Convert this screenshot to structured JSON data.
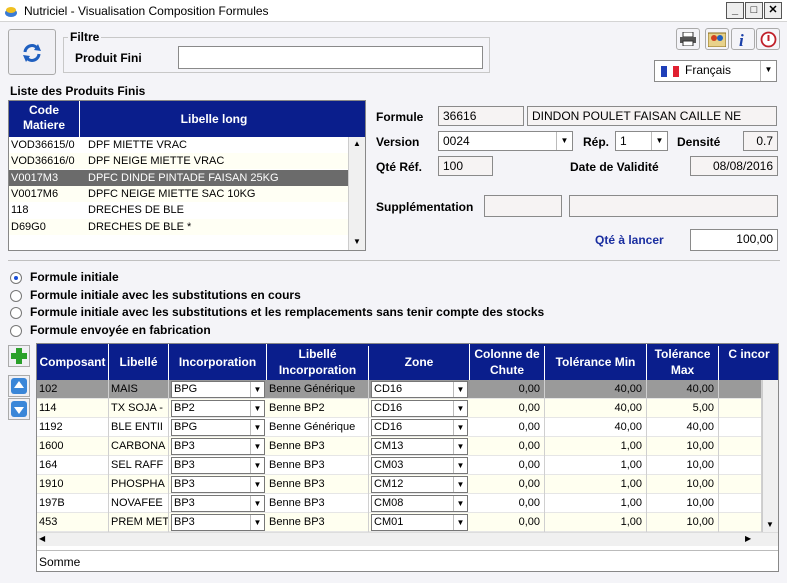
{
  "window": {
    "title": "Nutriciel - Visualisation Composition Formules"
  },
  "filter": {
    "group_label": "Filtre",
    "produit_label": "Produit Fini",
    "produit_value": ""
  },
  "language": {
    "value": "Français"
  },
  "list": {
    "title": "Liste des Produits Finis",
    "col_code": "Code Matiere",
    "col_libelle": "Libelle long",
    "rows": [
      {
        "code": "VOD36615/0",
        "libelle": "DPF MIETTE VRAC"
      },
      {
        "code": "VOD36616/0",
        "libelle": "DPF NEIGE MIETTE VRAC"
      },
      {
        "code": "V0017M3",
        "libelle": "DPFC DINDE PINTADE FAISAN 25KG"
      },
      {
        "code": "V0017M6",
        "libelle": "DPFC NEIGE MIETTE SAC 10KG"
      },
      {
        "code": "118",
        "libelle": "DRECHES DE BLE"
      },
      {
        "code": "D69G0",
        "libelle": "DRECHES DE BLE *"
      }
    ]
  },
  "formule": {
    "formule_label": "Formule",
    "formule_code": "36616",
    "formule_name": "DINDON POULET FAISAN CAILLE NE",
    "version_label": "Version",
    "version_value": "0024",
    "rep_label": "Rép.",
    "rep_value": "1",
    "densite_label": "Densité",
    "densite_value": "0.7",
    "qte_ref_label": "Qté Réf.",
    "qte_ref_value": "100",
    "validite_label": "Date de Validité",
    "validite_value": "08/08/2016",
    "supp_label": "Supplémentation",
    "supp_value1": "",
    "supp_value2": "",
    "qte_lancer_label": "Qté à lancer",
    "qte_lancer_value": "100,00"
  },
  "radios": [
    {
      "label": "Formule initiale",
      "checked": true
    },
    {
      "label": "Formule initiale avec les substitutions en cours",
      "checked": false
    },
    {
      "label": "Formule initiale avec les substitutions et les remplacements sans tenir compte des stocks",
      "checked": false
    },
    {
      "label": "Formule envoyée en fabrication",
      "checked": false
    }
  ],
  "grid": {
    "headers": {
      "composant": "Composant",
      "libelle": "Libellé",
      "incorporation": "Incorporation",
      "libelle_incorp": "Libellé Incorporation",
      "zone": "Zone",
      "colonne_chute": "Colonne de Chute",
      "tol_min": "Tolérance Min",
      "tol_max": "Tolérance Max",
      "last": "C incor"
    },
    "rows": [
      {
        "composant": "102",
        "libelle": "MAIS",
        "incorporation": "BPG",
        "libelle_incorp": "Benne Générique",
        "zone": "CD16",
        "chute": "0,00",
        "tmin": "40,00",
        "tmax": "40,00"
      },
      {
        "composant": "114",
        "libelle": "TX SOJA -",
        "incorporation": "BP2",
        "libelle_incorp": "Benne BP2",
        "zone": "CD16",
        "chute": "0,00",
        "tmin": "40,00",
        "tmax": "5,00"
      },
      {
        "composant": "1192",
        "libelle": "BLE ENTII",
        "incorporation": "BPG",
        "libelle_incorp": "Benne Générique",
        "zone": "CD16",
        "chute": "0,00",
        "tmin": "40,00",
        "tmax": "40,00"
      },
      {
        "composant": "1600",
        "libelle": "CARBONA",
        "incorporation": "BP3",
        "libelle_incorp": "Benne BP3",
        "zone": "CM13",
        "chute": "0,00",
        "tmin": "1,00",
        "tmax": "10,00"
      },
      {
        "composant": "164",
        "libelle": "SEL RAFF",
        "incorporation": "BP3",
        "libelle_incorp": "Benne BP3",
        "zone": "CM03",
        "chute": "0,00",
        "tmin": "1,00",
        "tmax": "10,00"
      },
      {
        "composant": "1910",
        "libelle": "PHOSPHA",
        "incorporation": "BP3",
        "libelle_incorp": "Benne BP3",
        "zone": "CM12",
        "chute": "0,00",
        "tmin": "1,00",
        "tmax": "10,00"
      },
      {
        "composant": "197B",
        "libelle": "NOVAFEE",
        "incorporation": "BP3",
        "libelle_incorp": "Benne BP3",
        "zone": "CM08",
        "chute": "0,00",
        "tmin": "1,00",
        "tmax": "10,00"
      },
      {
        "composant": "453",
        "libelle": "PREM MET",
        "incorporation": "BP3",
        "libelle_incorp": "Benne BP3",
        "zone": "CM01",
        "chute": "0,00",
        "tmin": "1,00",
        "tmax": "10,00"
      }
    ],
    "footer": "Somme"
  }
}
